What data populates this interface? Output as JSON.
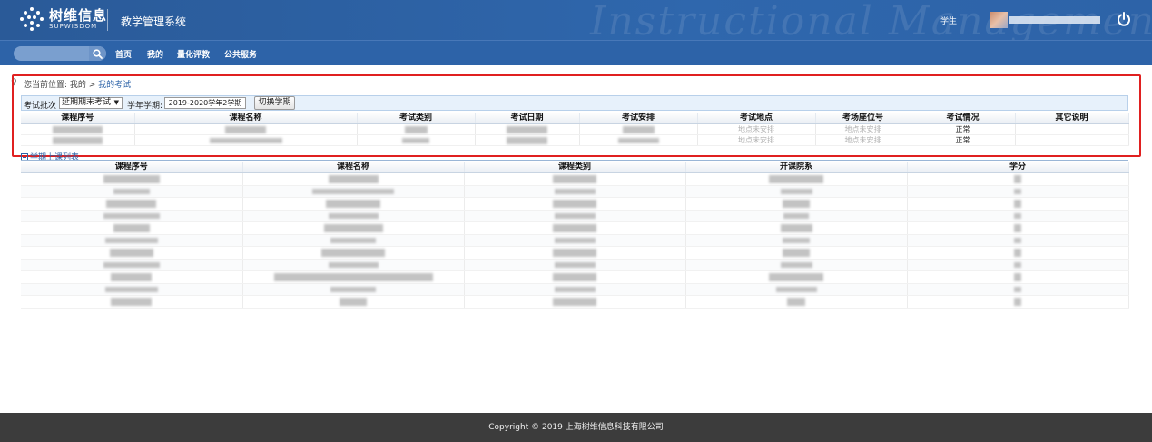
{
  "header": {
    "logo_cn": "树维信息",
    "logo_en": "SUPWISDOM",
    "system_title": "教学管理系统",
    "watermark": "Instructional Management",
    "role": "学生"
  },
  "nav": {
    "items": [
      "首页",
      "我的",
      "量化评教",
      "公共服务"
    ]
  },
  "breadcrumb": {
    "prefix": "您当前位置: 我的 > ",
    "current": "我的考试"
  },
  "filter": {
    "batch_label": "考试批次",
    "batch_value": "延期期末考试",
    "term_label": "学年学期:",
    "term_value": "2019-2020学年2学期",
    "switch_label": "切换学期"
  },
  "exam_table": {
    "headers": [
      "课程序号",
      "课程名称",
      "考试类别",
      "考试日期",
      "考试安排",
      "考试地点",
      "考场座位号",
      "考试情况",
      "其它说明"
    ],
    "rows": [
      {
        "location": "地点未安排",
        "seat": "地点未安排",
        "status": "正常"
      },
      {
        "location": "地点未安排",
        "seat": "地点未安排",
        "status": "正常"
      }
    ]
  },
  "course_section": {
    "title": "学期上课列表",
    "headers": [
      "课程序号",
      "课程名称",
      "课程类别",
      "开课院系",
      "学分"
    ],
    "row_count": 11
  },
  "footer": {
    "copyright": "Copyright © 2019 上海树维信息科技有限公司"
  },
  "colors": {
    "header_bg": "#2f67ad",
    "nav_bg": "#2d63a8",
    "highlight_box": "#e02020",
    "footer_bg": "#3c3c3c"
  }
}
